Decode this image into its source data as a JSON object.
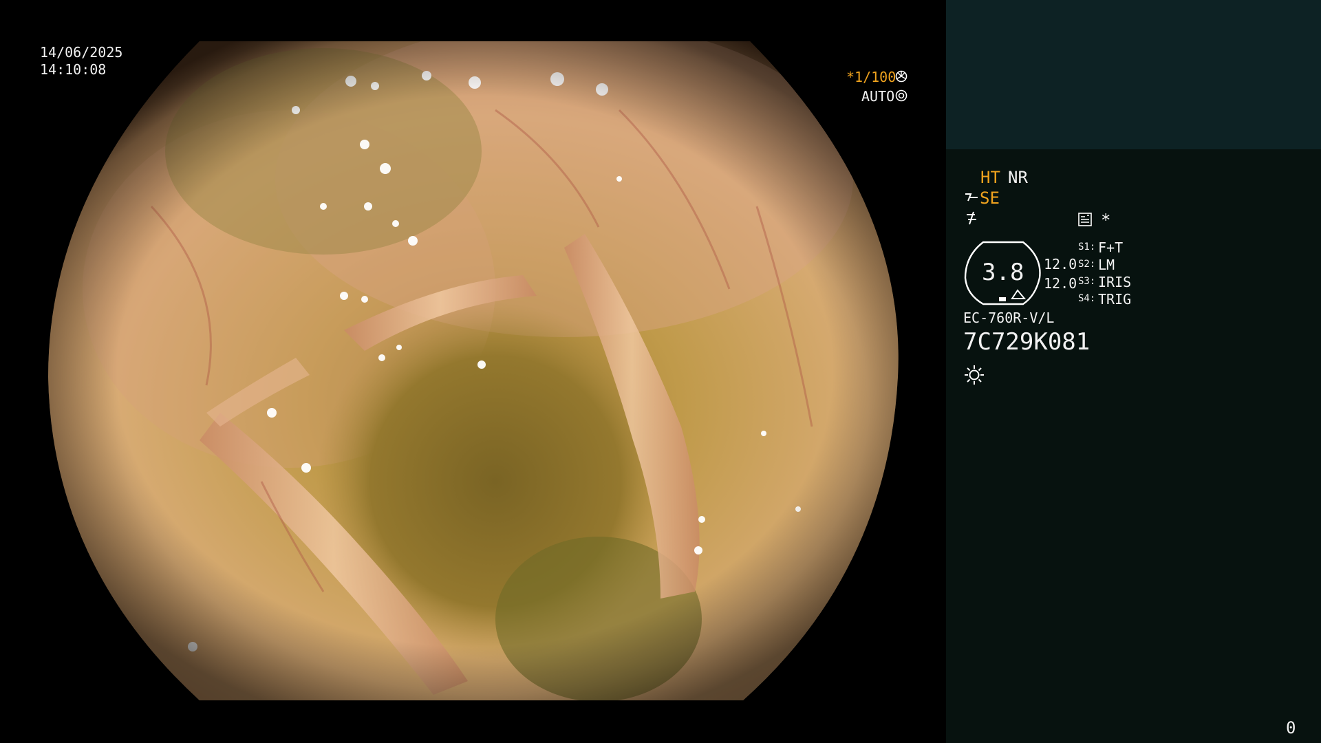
{
  "overlay": {
    "date": "14/06/2025",
    "time": "14:10:08",
    "shutter": "*1/100",
    "shutter_icon": "aperture-icon",
    "iris_mode": "AUTO",
    "iris_icon": "iris-icon"
  },
  "panel": {
    "ht": "HT",
    "nr": "NR",
    "se": "SE",
    "se_icon": "structure-enhance-icon",
    "gamma_icon": "gamma-icon",
    "memo_icon": "memo-icon",
    "asterisk": "*",
    "zoom_value": "3.8",
    "values": [
      "12.0",
      "12.0"
    ],
    "switches": [
      {
        "key": "S1:",
        "value": "F+T"
      },
      {
        "key": "S2:",
        "value": "LM"
      },
      {
        "key": "S3:",
        "value": "IRIS"
      },
      {
        "key": "S4:",
        "value": "TRIG"
      }
    ],
    "scope_model": "EC-760R-V/L",
    "serial": "7C729K081",
    "light_icon": "sun-icon",
    "counter": "0"
  },
  "colors": {
    "accent": "#f0a31e",
    "panel_bg": "#07120f",
    "panel_top_bg": "#0d2224"
  }
}
